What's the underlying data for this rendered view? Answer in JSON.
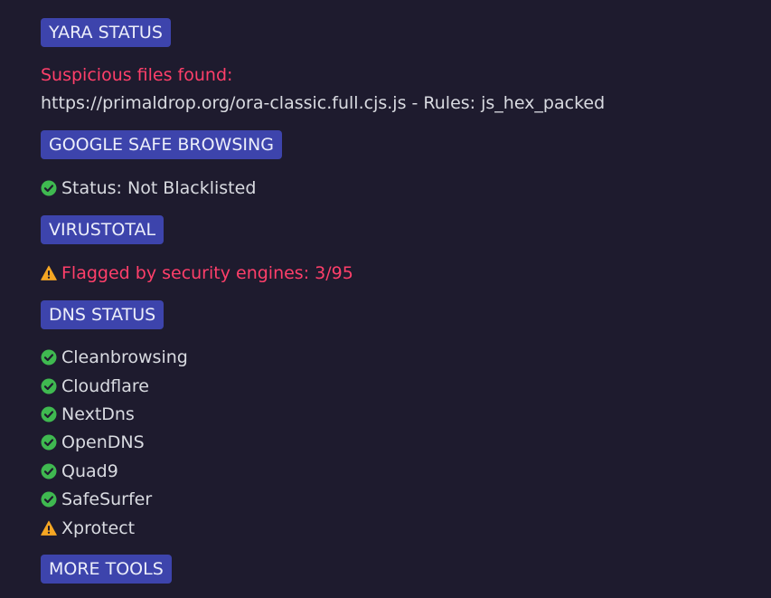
{
  "yara": {
    "badge": "YARA STATUS",
    "alert": "Suspicious files found:",
    "finding": "https://primaldrop.org/ora-classic.full.cjs.js - Rules: js_hex_packed"
  },
  "google": {
    "badge": "GOOGLE SAFE BROWSING",
    "status": "Status: Not Blacklisted",
    "status_icon": "check-circle-icon"
  },
  "virustotal": {
    "badge": "VIRUSTOTAL",
    "flagged": "Flagged by security engines: 3/95",
    "flagged_icon": "warning-icon"
  },
  "dns": {
    "badge": "DNS STATUS",
    "providers": [
      {
        "name": "Cleanbrowsing",
        "status": "ok",
        "icon": "check-circle-icon"
      },
      {
        "name": "Cloudflare",
        "status": "ok",
        "icon": "check-circle-icon"
      },
      {
        "name": "NextDns",
        "status": "ok",
        "icon": "check-circle-icon"
      },
      {
        "name": "OpenDNS",
        "status": "ok",
        "icon": "check-circle-icon"
      },
      {
        "name": "Quad9",
        "status": "ok",
        "icon": "check-circle-icon"
      },
      {
        "name": "SafeSurfer",
        "status": "ok",
        "icon": "check-circle-icon"
      },
      {
        "name": "Xprotect",
        "status": "warning",
        "icon": "warning-icon"
      }
    ]
  },
  "more_tools": {
    "badge": "MORE TOOLS"
  },
  "colors": {
    "background": "#1e1b2e",
    "badge_bg": "#3d44ac",
    "text": "#d9dbe1",
    "danger": "#ff3f6a",
    "ok": "#3fb950",
    "warning": "#f5a623"
  }
}
